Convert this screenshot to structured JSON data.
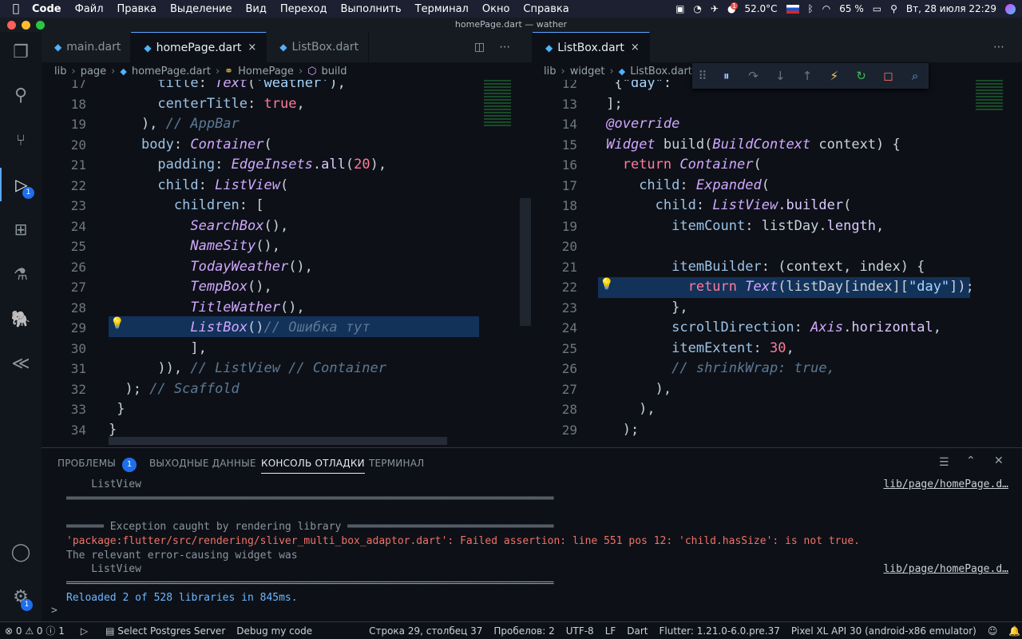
{
  "menubar": {
    "app": "Code",
    "items": [
      "Файл",
      "Правка",
      "Выделение",
      "Вид",
      "Переход",
      "Выполнить",
      "Терминал",
      "Окно",
      "Справка"
    ],
    "temp": "52.0°C",
    "battery": "65 %",
    "clock": "Вт, 28 июля  22:29",
    "notif_badge": "1"
  },
  "window": {
    "title": "homePage.dart — wather"
  },
  "activity": {
    "debug_badge": "1",
    "settings_badge": "1"
  },
  "left_editor": {
    "tabs": [
      {
        "label": "main.dart"
      },
      {
        "label": "homePage.dart",
        "close": "×"
      },
      {
        "label": "ListBox.dart"
      }
    ],
    "breadcrumb": [
      "lib",
      "page",
      "homePage.dart",
      "HomePage",
      "build"
    ],
    "lines": [
      {
        "n": "17",
        "t": "      title: Text('weather'),"
      },
      {
        "n": "18",
        "t": "      centerTitle: true,"
      },
      {
        "n": "19",
        "t": "    ), // AppBar"
      },
      {
        "n": "20",
        "t": "    body: Container("
      },
      {
        "n": "21",
        "t": "      padding: EdgeInsets.all(20),"
      },
      {
        "n": "22",
        "t": "      child: ListView("
      },
      {
        "n": "23",
        "t": "        children: ["
      },
      {
        "n": "24",
        "t": "          SearchBox(),"
      },
      {
        "n": "25",
        "t": "          NameSity(),"
      },
      {
        "n": "26",
        "t": "          TodayWeather(),"
      },
      {
        "n": "27",
        "t": "          TempBox(),"
      },
      {
        "n": "28",
        "t": "          TitleWather(),"
      },
      {
        "n": "29",
        "t": "          ListBox()// Ошибка тут"
      },
      {
        "n": "30",
        "t": "          ],"
      },
      {
        "n": "31",
        "t": "      )), // ListView // Container"
      },
      {
        "n": "32",
        "t": "  ); // Scaffold"
      },
      {
        "n": "33",
        "t": " }"
      },
      {
        "n": "34",
        "t": "}"
      }
    ]
  },
  "right_editor": {
    "tabs": [
      {
        "label": "ListBox.dart",
        "close": "×"
      }
    ],
    "breadcrumb": [
      "lib",
      "widget",
      "ListBox.dart"
    ],
    "lines": [
      {
        "n": "12",
        "t": "  {\"day\":"
      },
      {
        "n": "13",
        "t": " ];"
      },
      {
        "n": "14",
        "t": " @override"
      },
      {
        "n": "15",
        "t": " Widget build(BuildContext context) {"
      },
      {
        "n": "16",
        "t": "   return Container("
      },
      {
        "n": "17",
        "t": "     child: Expanded("
      },
      {
        "n": "18",
        "t": "       child: ListView.builder("
      },
      {
        "n": "19",
        "t": "         itemCount: listDay.length,"
      },
      {
        "n": "20",
        "t": ""
      },
      {
        "n": "21",
        "t": "         itemBuilder: (context, index) {"
      },
      {
        "n": "22",
        "t": "           return Text(listDay[index][\"day\"]);"
      },
      {
        "n": "23",
        "t": "         },"
      },
      {
        "n": "24",
        "t": "         scrollDirection: Axis.horizontal,"
      },
      {
        "n": "25",
        "t": "         itemExtent: 30,"
      },
      {
        "n": "26",
        "t": "         // shrinkWrap: true,"
      },
      {
        "n": "27",
        "t": "       ),"
      },
      {
        "n": "28",
        "t": "     ),"
      },
      {
        "n": "29",
        "t": "   );"
      }
    ]
  },
  "panel": {
    "tabs": [
      {
        "label": "ПРОБЛЕМЫ",
        "badge": "1"
      },
      {
        "label": "ВЫХОДНЫЕ ДАННЫЕ"
      },
      {
        "label": "КОНСОЛЬ ОТЛАДКИ"
      },
      {
        "label": "ТЕРМИНАЛ"
      }
    ],
    "lines": [
      {
        "t": "    ListView",
        "link": "lib/page/homePage.d…"
      },
      {
        "t": "══════════════════════════════════════════════════════════════════════════════"
      },
      {
        "t": ""
      },
      {
        "t": "══════ Exception caught by rendering library ═════════════════════════════════"
      },
      {
        "t": "'package:flutter/src/rendering/sliver_multi_box_adaptor.dart': Failed assertion: line 551 pos 12: 'child.hasSize': is not true.",
        "cls": "err"
      },
      {
        "t": "The relevant error-causing widget was"
      },
      {
        "t": "    ListView",
        "link": "lib/page/homePage.d…"
      },
      {
        "t": "══════════════════════════════════════════════════════════════════════════════"
      },
      {
        "t": "Reloaded 2 of 528 libraries in 845ms.",
        "cls": "info"
      }
    ],
    "prompt": ">"
  },
  "statusbar": {
    "problems_errors": "0",
    "problems_warnings": "0",
    "info": "1",
    "postgres": "Select Postgres Server",
    "debug": "Debug my code",
    "position": "Строка 29, столбец 37",
    "spaces": "Пробелов: 2",
    "encoding": "UTF-8",
    "eol": "LF",
    "lang": "Dart",
    "flutter": "Flutter: 1.21.0-6.0.pre.37",
    "device": "Pixel XL API 30 (android-x86 emulator)"
  }
}
